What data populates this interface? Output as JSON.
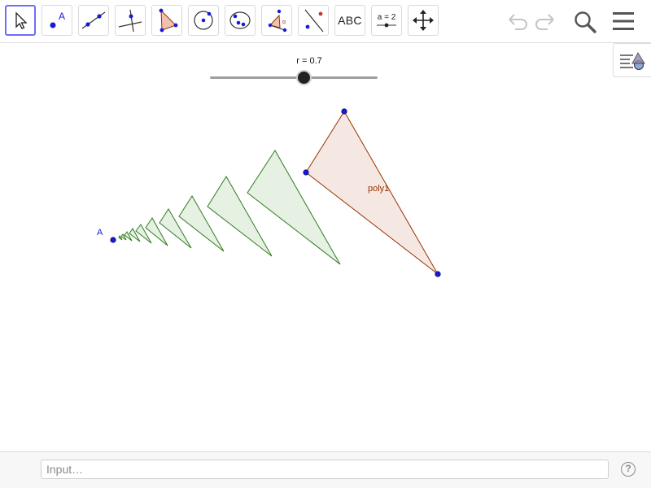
{
  "toolbar": {
    "tools": [
      {
        "name": "move-tool",
        "icon": "arrow-cursor-icon"
      },
      {
        "name": "point-tool",
        "icon": "point-icon"
      },
      {
        "name": "line-tool",
        "icon": "line-through-points-icon"
      },
      {
        "name": "perpendicular-line-tool",
        "icon": "perpendicular-line-icon"
      },
      {
        "name": "polygon-tool",
        "icon": "polygon-icon"
      },
      {
        "name": "circle-tool",
        "icon": "circle-center-point-icon"
      },
      {
        "name": "circle-three-points-tool",
        "icon": "circle-three-points-icon"
      },
      {
        "name": "angle-tool",
        "icon": "angle-icon"
      },
      {
        "name": "reflect-tool",
        "icon": "reflect-about-line-icon"
      },
      {
        "name": "text-tool",
        "icon": "text-icon",
        "label": "ABC"
      },
      {
        "name": "slider-tool",
        "icon": "slider-icon",
        "label": "a = 2"
      },
      {
        "name": "move-graphics-tool",
        "icon": "move-arrows-icon"
      }
    ],
    "right_icons": [
      "undo-icon",
      "redo-icon",
      "search-icon",
      "menu-icon"
    ]
  },
  "stylebar": {
    "icon": "style-bar-icon"
  },
  "slider": {
    "label": "r = 0.7",
    "value": 0.7
  },
  "canvas": {
    "point_label_A": "A",
    "polygon_label": "poly1"
  },
  "input": {
    "placeholder": "Input…"
  },
  "help": {
    "label": "?"
  },
  "colors": {
    "accent": "#6d6ff0",
    "point": "#1a1ad6",
    "polygon_stroke": "#993300",
    "polygon_fill": "#f3e4de",
    "iter_stroke": "#2f7d1f",
    "iter_fill": "#e6f0e3"
  }
}
